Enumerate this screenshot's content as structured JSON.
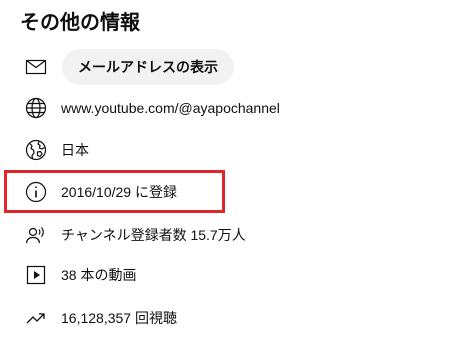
{
  "section": {
    "title": "その他の情報"
  },
  "rows": {
    "email": {
      "icon": "mail-icon",
      "button_label": "メールアドレスの表示"
    },
    "url": {
      "icon": "globe-icon",
      "text": "www.youtube.com/@ayapochannel"
    },
    "country": {
      "icon": "world-map-icon",
      "text": "日本"
    },
    "joined": {
      "icon": "info-icon",
      "text": "2016/10/29 に登録"
    },
    "subscribers": {
      "icon": "person-voice-icon",
      "text": "チャンネル登録者数 15.7万人"
    },
    "videos": {
      "icon": "play-square-icon",
      "text": "38 本の動画"
    },
    "views": {
      "icon": "trending-up-icon",
      "text": "16,128,357 回視聴"
    }
  },
  "colors": {
    "highlight_border": "#e0252b",
    "pill_background": "#f2f2f2",
    "text": "#0f0f0f"
  }
}
